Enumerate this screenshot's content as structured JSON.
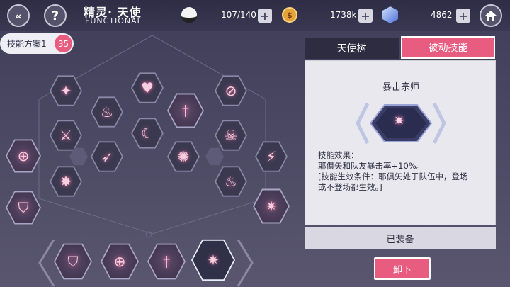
{
  "header": {
    "title": "精灵· 天使",
    "subtitle": "FUNCTIONAL",
    "back_icon": "double-chevron-left-icon",
    "help_label": "?",
    "stamina": "107/140",
    "gold": "1738k",
    "gems": "4862",
    "home_icon": "home-icon",
    "gold_symbol": "$"
  },
  "scheme": {
    "label": "技能方案1",
    "badge": "35"
  },
  "tabs": [
    {
      "label": "天使树",
      "active": false
    },
    {
      "label": "被动技能",
      "active": true
    }
  ],
  "skill_detail": {
    "name": "暴击宗师",
    "effect_line1": "技能效果：",
    "effect_line2": "耶俱矢和队友暴击率+10%。",
    "effect_line3": "[技能生效条件：耶俱矢处于队伍中，登场",
    "effect_line4": "或不登场都生效。]",
    "status": "已装备",
    "action": "卸下"
  },
  "colors": {
    "accent": "#e85c80",
    "background": "#4a4862",
    "panel": "#e9e8ef"
  },
  "tree_icons": [
    "compass-star-icon",
    "heart-arrow-icon",
    "shield-slash-icon",
    "crossed-swords-icon",
    "sword-up-icon",
    "crescent-icon",
    "skull-gear-icon",
    "dash-arrow-icon",
    "swirl-icon",
    "fountain-icon",
    "sword-diagonal-icon",
    "target-skull-icon",
    "shield-icon",
    "flame-burst-icon",
    "fountain-flame-icon",
    "critical-burst-icon"
  ],
  "equipped_slots": [
    "shield-icon",
    "target-skull-icon",
    "sword-burst-icon",
    "critical-burst-icon"
  ]
}
